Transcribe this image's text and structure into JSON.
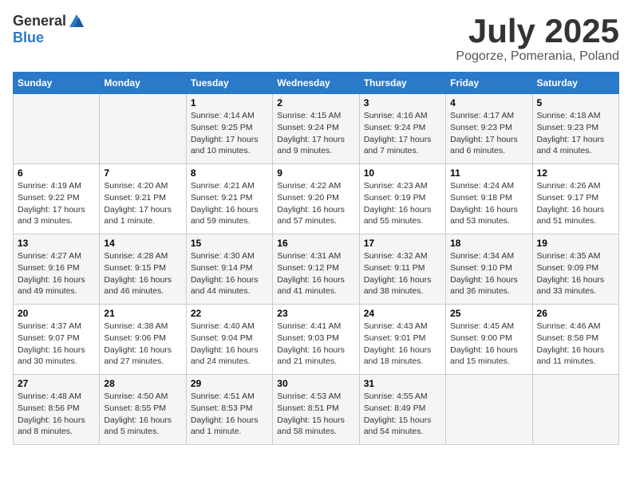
{
  "header": {
    "logo_general": "General",
    "logo_blue": "Blue",
    "title": "July 2025",
    "location": "Pogorze, Pomerania, Poland"
  },
  "days_of_week": [
    "Sunday",
    "Monday",
    "Tuesday",
    "Wednesday",
    "Thursday",
    "Friday",
    "Saturday"
  ],
  "weeks": [
    [
      {
        "num": "",
        "info": ""
      },
      {
        "num": "",
        "info": ""
      },
      {
        "num": "1",
        "info": "Sunrise: 4:14 AM\nSunset: 9:25 PM\nDaylight: 17 hours and 10 minutes."
      },
      {
        "num": "2",
        "info": "Sunrise: 4:15 AM\nSunset: 9:24 PM\nDaylight: 17 hours and 9 minutes."
      },
      {
        "num": "3",
        "info": "Sunrise: 4:16 AM\nSunset: 9:24 PM\nDaylight: 17 hours and 7 minutes."
      },
      {
        "num": "4",
        "info": "Sunrise: 4:17 AM\nSunset: 9:23 PM\nDaylight: 17 hours and 6 minutes."
      },
      {
        "num": "5",
        "info": "Sunrise: 4:18 AM\nSunset: 9:23 PM\nDaylight: 17 hours and 4 minutes."
      }
    ],
    [
      {
        "num": "6",
        "info": "Sunrise: 4:19 AM\nSunset: 9:22 PM\nDaylight: 17 hours and 3 minutes."
      },
      {
        "num": "7",
        "info": "Sunrise: 4:20 AM\nSunset: 9:21 PM\nDaylight: 17 hours and 1 minute."
      },
      {
        "num": "8",
        "info": "Sunrise: 4:21 AM\nSunset: 9:21 PM\nDaylight: 16 hours and 59 minutes."
      },
      {
        "num": "9",
        "info": "Sunrise: 4:22 AM\nSunset: 9:20 PM\nDaylight: 16 hours and 57 minutes."
      },
      {
        "num": "10",
        "info": "Sunrise: 4:23 AM\nSunset: 9:19 PM\nDaylight: 16 hours and 55 minutes."
      },
      {
        "num": "11",
        "info": "Sunrise: 4:24 AM\nSunset: 9:18 PM\nDaylight: 16 hours and 53 minutes."
      },
      {
        "num": "12",
        "info": "Sunrise: 4:26 AM\nSunset: 9:17 PM\nDaylight: 16 hours and 51 minutes."
      }
    ],
    [
      {
        "num": "13",
        "info": "Sunrise: 4:27 AM\nSunset: 9:16 PM\nDaylight: 16 hours and 49 minutes."
      },
      {
        "num": "14",
        "info": "Sunrise: 4:28 AM\nSunset: 9:15 PM\nDaylight: 16 hours and 46 minutes."
      },
      {
        "num": "15",
        "info": "Sunrise: 4:30 AM\nSunset: 9:14 PM\nDaylight: 16 hours and 44 minutes."
      },
      {
        "num": "16",
        "info": "Sunrise: 4:31 AM\nSunset: 9:12 PM\nDaylight: 16 hours and 41 minutes."
      },
      {
        "num": "17",
        "info": "Sunrise: 4:32 AM\nSunset: 9:11 PM\nDaylight: 16 hours and 38 minutes."
      },
      {
        "num": "18",
        "info": "Sunrise: 4:34 AM\nSunset: 9:10 PM\nDaylight: 16 hours and 36 minutes."
      },
      {
        "num": "19",
        "info": "Sunrise: 4:35 AM\nSunset: 9:09 PM\nDaylight: 16 hours and 33 minutes."
      }
    ],
    [
      {
        "num": "20",
        "info": "Sunrise: 4:37 AM\nSunset: 9:07 PM\nDaylight: 16 hours and 30 minutes."
      },
      {
        "num": "21",
        "info": "Sunrise: 4:38 AM\nSunset: 9:06 PM\nDaylight: 16 hours and 27 minutes."
      },
      {
        "num": "22",
        "info": "Sunrise: 4:40 AM\nSunset: 9:04 PM\nDaylight: 16 hours and 24 minutes."
      },
      {
        "num": "23",
        "info": "Sunrise: 4:41 AM\nSunset: 9:03 PM\nDaylight: 16 hours and 21 minutes."
      },
      {
        "num": "24",
        "info": "Sunrise: 4:43 AM\nSunset: 9:01 PM\nDaylight: 16 hours and 18 minutes."
      },
      {
        "num": "25",
        "info": "Sunrise: 4:45 AM\nSunset: 9:00 PM\nDaylight: 16 hours and 15 minutes."
      },
      {
        "num": "26",
        "info": "Sunrise: 4:46 AM\nSunset: 8:58 PM\nDaylight: 16 hours and 11 minutes."
      }
    ],
    [
      {
        "num": "27",
        "info": "Sunrise: 4:48 AM\nSunset: 8:56 PM\nDaylight: 16 hours and 8 minutes."
      },
      {
        "num": "28",
        "info": "Sunrise: 4:50 AM\nSunset: 8:55 PM\nDaylight: 16 hours and 5 minutes."
      },
      {
        "num": "29",
        "info": "Sunrise: 4:51 AM\nSunset: 8:53 PM\nDaylight: 16 hours and 1 minute."
      },
      {
        "num": "30",
        "info": "Sunrise: 4:53 AM\nSunset: 8:51 PM\nDaylight: 15 hours and 58 minutes."
      },
      {
        "num": "31",
        "info": "Sunrise: 4:55 AM\nSunset: 8:49 PM\nDaylight: 15 hours and 54 minutes."
      },
      {
        "num": "",
        "info": ""
      },
      {
        "num": "",
        "info": ""
      }
    ]
  ]
}
